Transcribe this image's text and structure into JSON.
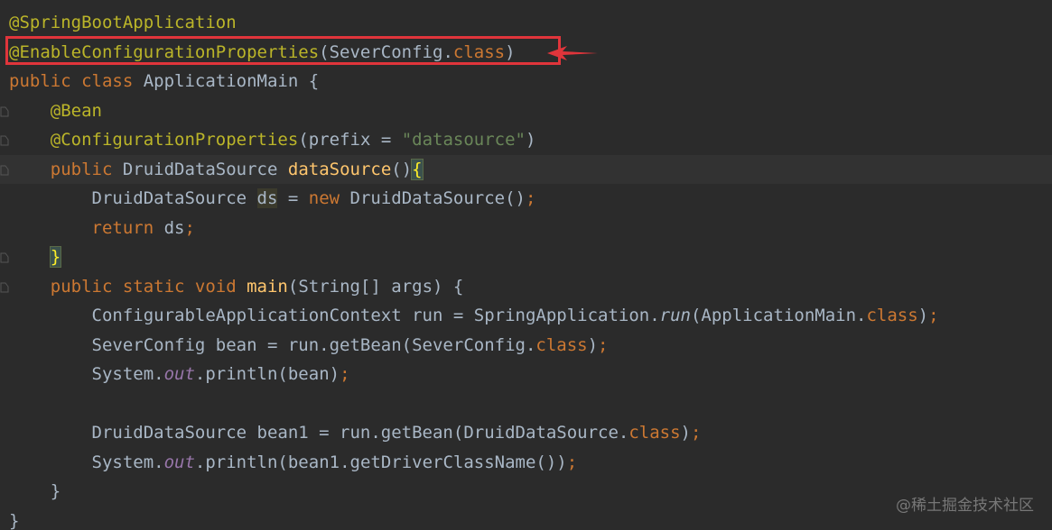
{
  "editor": {
    "theme": "dark",
    "colors": {
      "background": "#2b2b2b",
      "annotation": "#bbb529",
      "keyword": "#cc7832",
      "method": "#ffc66d",
      "string": "#6a8759",
      "identifier": "#a9b7c6",
      "static_field": "#9876aa",
      "highlight_box": "#e0353b"
    },
    "lines": [
      {
        "tokens": [
          {
            "t": "@SpringBootApplication",
            "k": "ann"
          }
        ]
      },
      {
        "tokens": [
          {
            "t": "@EnableConfigurationProperties",
            "k": "ann"
          },
          {
            "t": "(SeverConfig.",
            "k": "id"
          },
          {
            "t": "class",
            "k": "kw"
          },
          {
            "t": ")",
            "k": "id"
          }
        ]
      },
      {
        "tokens": [
          {
            "t": "public class ",
            "k": "kw"
          },
          {
            "t": "ApplicationMain {",
            "k": "id"
          }
        ]
      },
      {
        "gutter": "fold",
        "tokens": [
          {
            "t": "    ",
            "k": "id"
          },
          {
            "t": "@Bean",
            "k": "ann"
          }
        ]
      },
      {
        "gutter": "fold",
        "tokens": [
          {
            "t": "    ",
            "k": "id"
          },
          {
            "t": "@ConfigurationProperties",
            "k": "ann"
          },
          {
            "t": "(prefix = ",
            "k": "id"
          },
          {
            "t": "\"datasource\"",
            "k": "str"
          },
          {
            "t": ")",
            "k": "id"
          }
        ]
      },
      {
        "current": true,
        "gutter": "fold",
        "tokens": [
          {
            "t": "    ",
            "k": "id"
          },
          {
            "t": "public ",
            "k": "kw"
          },
          {
            "t": "DruidDataSource ",
            "k": "id"
          },
          {
            "t": "dataSource",
            "k": "fn"
          },
          {
            "t": "()",
            "k": "id"
          },
          {
            "t": "{",
            "k": "brace"
          }
        ]
      },
      {
        "tokens": [
          {
            "t": "        DruidDataSource ",
            "k": "id"
          },
          {
            "t": "ds",
            "k": "usage"
          },
          {
            "t": " = ",
            "k": "id"
          },
          {
            "t": "new ",
            "k": "kw"
          },
          {
            "t": "DruidDataSource()",
            "k": "id"
          },
          {
            "t": ";",
            "k": "semi"
          }
        ]
      },
      {
        "tokens": [
          {
            "t": "        ",
            "k": "id"
          },
          {
            "t": "return ",
            "k": "kw"
          },
          {
            "t": "ds",
            "k": "id"
          },
          {
            "t": ";",
            "k": "semi"
          }
        ]
      },
      {
        "gutter": "fold",
        "tokens": [
          {
            "t": "    ",
            "k": "id"
          },
          {
            "t": "}",
            "k": "brace"
          }
        ]
      },
      {
        "gutter": "fold",
        "tokens": [
          {
            "t": "    ",
            "k": "id"
          },
          {
            "t": "public static void ",
            "k": "kw"
          },
          {
            "t": "main",
            "k": "fn"
          },
          {
            "t": "(String[] args) {",
            "k": "id"
          }
        ]
      },
      {
        "tokens": [
          {
            "t": "        ConfigurableApplicationContext run = SpringApplication.",
            "k": "id"
          },
          {
            "t": "run",
            "k": "staticcall"
          },
          {
            "t": "(ApplicationMain.",
            "k": "id"
          },
          {
            "t": "class",
            "k": "kw"
          },
          {
            "t": ")",
            "k": "id"
          },
          {
            "t": ";",
            "k": "semi"
          }
        ]
      },
      {
        "tokens": [
          {
            "t": "        SeverConfig bean = run.getBean(SeverConfig.",
            "k": "id"
          },
          {
            "t": "class",
            "k": "kw"
          },
          {
            "t": ")",
            "k": "id"
          },
          {
            "t": ";",
            "k": "semi"
          }
        ]
      },
      {
        "tokens": [
          {
            "t": "        System.",
            "k": "id"
          },
          {
            "t": "out",
            "k": "static"
          },
          {
            "t": ".println(bean)",
            "k": "id"
          },
          {
            "t": ";",
            "k": "semi"
          }
        ]
      },
      {
        "tokens": [
          {
            "t": "",
            "k": "id"
          }
        ]
      },
      {
        "tokens": [
          {
            "t": "        DruidDataSource bean1 = run.getBean(DruidDataSource.",
            "k": "id"
          },
          {
            "t": "class",
            "k": "kw"
          },
          {
            "t": ")",
            "k": "id"
          },
          {
            "t": ";",
            "k": "semi"
          }
        ]
      },
      {
        "tokens": [
          {
            "t": "        System.",
            "k": "id"
          },
          {
            "t": "out",
            "k": "static"
          },
          {
            "t": ".println(bean1.getDriverClassName())",
            "k": "id"
          },
          {
            "t": ";",
            "k": "semi"
          }
        ]
      },
      {
        "tokens": [
          {
            "t": "    }",
            "k": "id"
          }
        ]
      },
      {
        "tokens": [
          {
            "t": "}",
            "k": "id"
          }
        ]
      }
    ]
  },
  "watermark": {
    "text": "@稀土掘金技术社区"
  }
}
